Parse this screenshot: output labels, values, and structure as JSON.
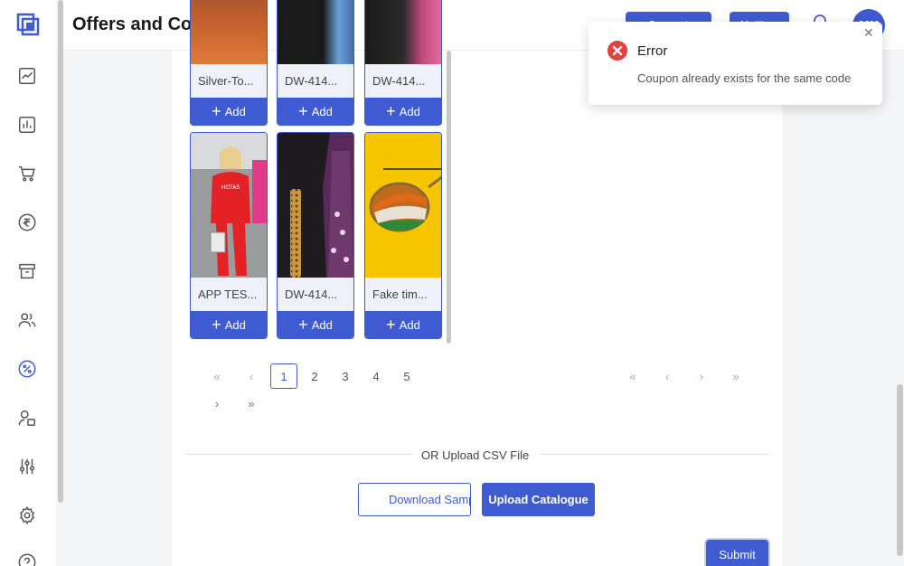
{
  "header": {
    "title": "Offers and Coupons",
    "btn1_label": "Connect",
    "btn2_label": "Mailbox",
    "avatar_initials": "MH"
  },
  "sidebar": {
    "items": [
      {
        "icon": "logo-icon"
      },
      {
        "icon": "trend-chart-icon"
      },
      {
        "icon": "bar-chart-icon"
      },
      {
        "icon": "cart-icon"
      },
      {
        "icon": "rupee-icon"
      },
      {
        "icon": "archive-icon"
      },
      {
        "icon": "users-icon"
      },
      {
        "icon": "percent-icon",
        "active": true
      },
      {
        "icon": "user-settings-icon"
      },
      {
        "icon": "sliders-icon"
      },
      {
        "icon": "gear-icon"
      },
      {
        "icon": "help-icon"
      }
    ]
  },
  "products": [
    {
      "name": "Silver-To...",
      "add_label": "Add"
    },
    {
      "name": "DW-414...",
      "add_label": "Add"
    },
    {
      "name": "DW-414...",
      "add_label": "Add"
    },
    {
      "name": "APP TES...",
      "add_label": "Add"
    },
    {
      "name": "DW-414...",
      "add_label": "Add"
    },
    {
      "name": "Fake tim...",
      "add_label": "Add"
    }
  ],
  "pagination": {
    "pages": [
      "1",
      "2",
      "3",
      "4",
      "5"
    ],
    "current": "1",
    "first": "«",
    "prev": "‹",
    "next": "›",
    "last": "»"
  },
  "upload": {
    "divider_text": "OR Upload CSV File",
    "download_label": "Download Sample",
    "upload_label": "Upload Catalogue"
  },
  "submit_label": "Submit",
  "toast": {
    "title": "Error",
    "message": "Coupon already exists for the same code",
    "close": "✕"
  },
  "colors": {
    "primary": "#3f5bd1",
    "error": "#e5413b"
  }
}
